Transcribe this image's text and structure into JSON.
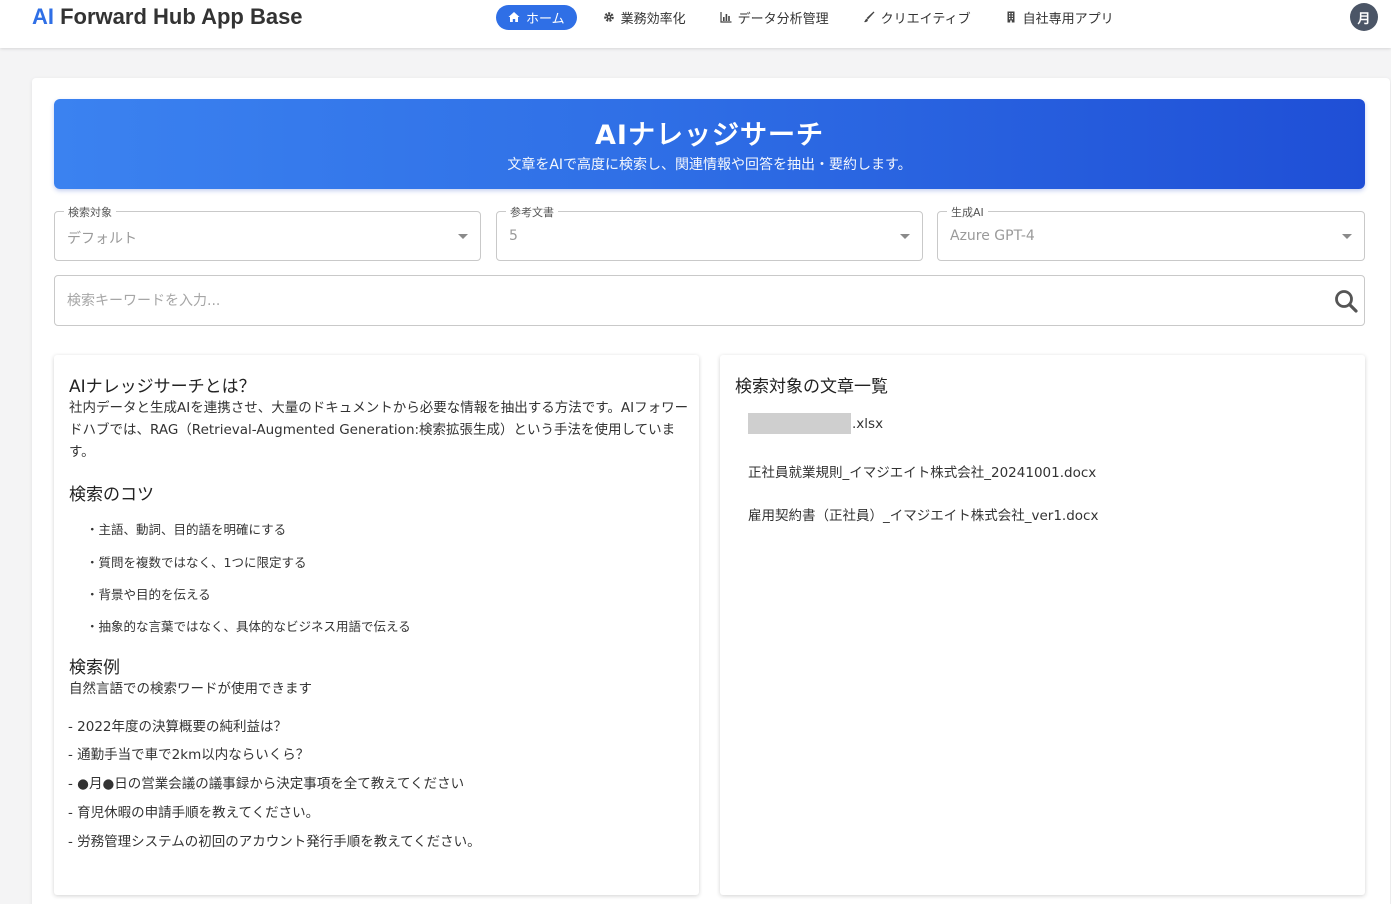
{
  "header": {
    "brand_ai": "AI",
    "brand_rest": " Forward Hub App Base",
    "nav": [
      {
        "label": "ホーム",
        "icon": "home-icon",
        "active": true
      },
      {
        "label": "業務効率化",
        "icon": "gear-icon",
        "active": false
      },
      {
        "label": "データ分析管理",
        "icon": "bar-chart-icon",
        "active": false
      },
      {
        "label": "クリエイティブ",
        "icon": "brush-icon",
        "active": false
      },
      {
        "label": "自社専用アプリ",
        "icon": "building-icon",
        "active": false
      }
    ],
    "avatar": "月"
  },
  "hero": {
    "title": "AIナレッジサーチ",
    "subtitle": "文章をAIで高度に検索し、関連情報や回答を抽出・要約します。"
  },
  "filters": {
    "target": {
      "label": "検索対象",
      "value": "デフォルト"
    },
    "refs": {
      "label": "参考文書",
      "value": "5"
    },
    "model": {
      "label": "生成AI",
      "value": "Azure GPT-4"
    }
  },
  "search": {
    "placeholder": "検索キーワードを入力..."
  },
  "about": {
    "title": "AIナレッジサーチとは？",
    "body": "社内データと生成AIを連携させ、大量のドキュメントから必要な情報を抽出する方法です。AIフォワードハブでは、RAG（Retrieval-Augmented Generation:検索拡張生成）という手法を使用しています。",
    "tips_title": "検索のコツ",
    "tips": [
      "・主語、動詞、目的語を明確にする",
      "・質問を複数ではなく、1つに限定する",
      "・背景や目的を伝える",
      "・抽象的な言葉ではなく、具体的なビジネス用語で伝える"
    ],
    "examples_title": "検索例",
    "examples_intro": "自然言語での検索ワードが使用できます",
    "examples": [
      "- 2022年度の決算概要の純利益は？",
      "- 通勤手当で車で2km以内ならいくら？",
      "- ●月●日の営業会議の議事録から決定事項を全て教えてください",
      "- 育児休暇の申請手順を教えてください。",
      "- 労務管理システムの初回のアカウント発行手順を教えてください。"
    ]
  },
  "docs": {
    "title": "検索対象の文章一覧",
    "items": [
      ".xlsx",
      "正社員就業規則_イマジエイト株式会社_20241001.docx",
      "雇用契約書（正社員）_イマジエイト株式会社_ver1.docx"
    ]
  },
  "colors": {
    "accent": "#2f6fe6",
    "hero_end": "#1f4fd6",
    "avatar": "#4b5566"
  }
}
